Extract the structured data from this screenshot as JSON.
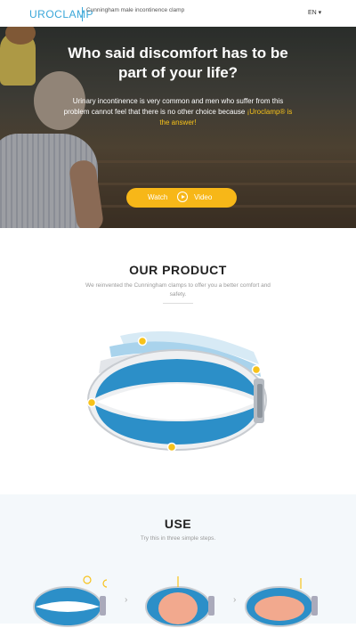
{
  "header": {
    "logo": "UROCLAMP",
    "tagline": "Cunningham male incontinence clamp",
    "language": "EN ▾"
  },
  "hero": {
    "title": "Who said discomfort has to be part of your life?",
    "text": "Urinary incontinence is very common and men who suffer from this problem cannot feel that there is no other choice because",
    "highlight": "¡Uroclamp® is the answer!",
    "button_watch": "Watch",
    "button_video": "Video"
  },
  "product": {
    "title": "OUR PRODUCT",
    "subtitle": "We reinvented the Cunningham clamps to offer you a better comfort and safety."
  },
  "use": {
    "title": "USE",
    "subtitle": "Try this in three simple steps."
  },
  "colors": {
    "brand": "#3aa7d9",
    "accent": "#f7b718",
    "clamp_blue": "#2c8fc8"
  }
}
